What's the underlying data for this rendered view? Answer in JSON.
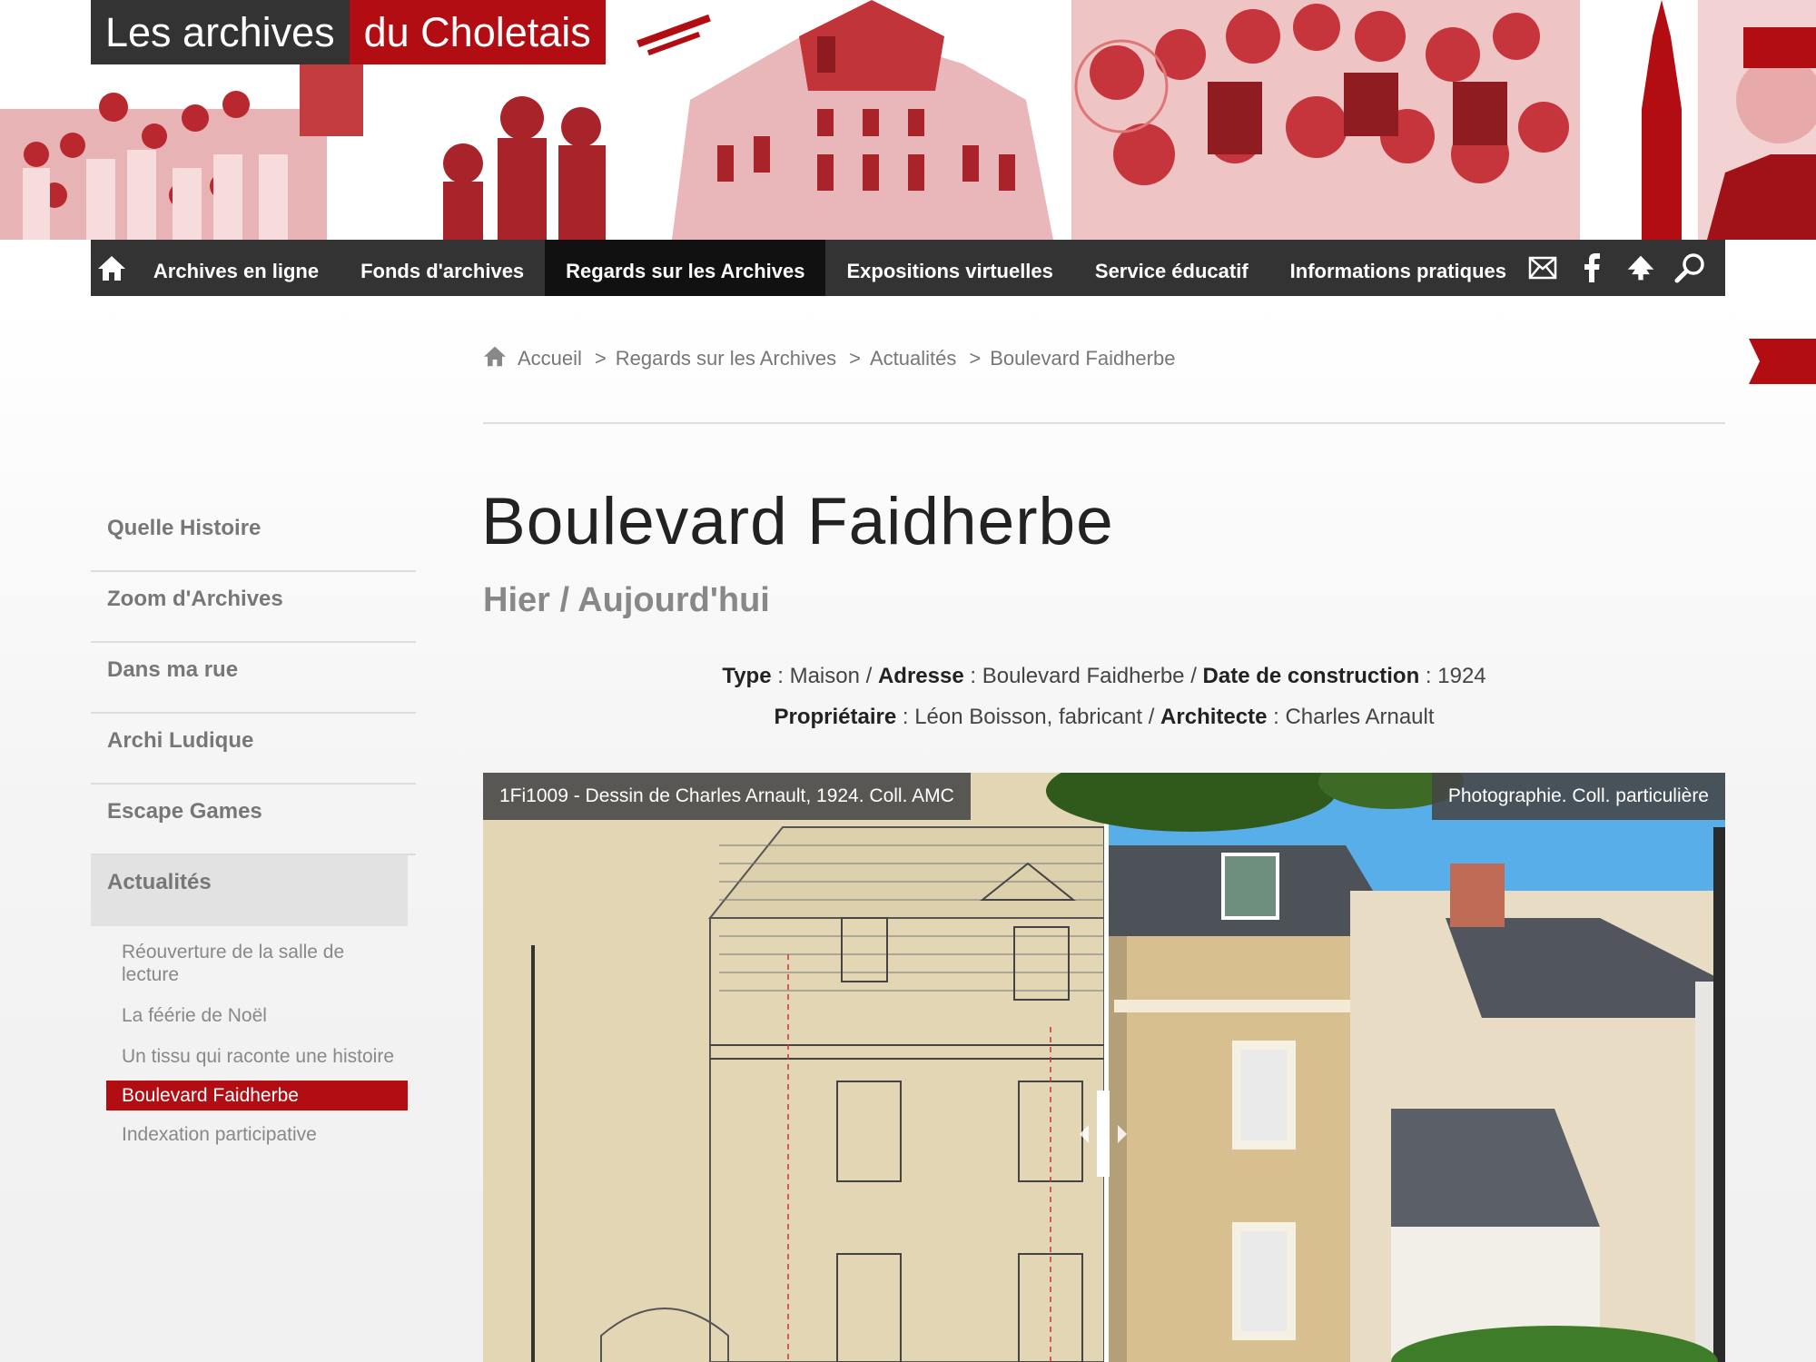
{
  "site": {
    "logo_part1": "Les archives",
    "logo_part2": "du Choletais",
    "brand_color": "#b30d14",
    "dark_color": "#333333"
  },
  "nav": {
    "home_icon": "home-icon",
    "items": [
      {
        "label": "Archives en ligne",
        "active": false
      },
      {
        "label": "Fonds d'archives",
        "active": false
      },
      {
        "label": "Regards sur les Archives",
        "active": true
      },
      {
        "label": "Expositions virtuelles",
        "active": false
      },
      {
        "label": "Service éducatif",
        "active": false
      },
      {
        "label": "Informations pratiques",
        "active": false
      }
    ],
    "icons": [
      "mail-icon",
      "facebook-icon",
      "tree-icon",
      "search-icon"
    ]
  },
  "breadcrumb": {
    "home": "Accueil",
    "level1": "Regards sur les Archives",
    "level2": "Actualités",
    "current": "Boulevard Faidherbe",
    "separator": ">"
  },
  "sidebar": {
    "items": [
      {
        "label": "Quelle Histoire"
      },
      {
        "label": "Zoom d'Archives"
      },
      {
        "label": "Dans ma rue"
      },
      {
        "label": "Archi Ludique"
      },
      {
        "label": "Escape Games"
      },
      {
        "label": "Actualités",
        "active": true
      }
    ],
    "sub_items": [
      {
        "label": "Réouverture de la salle de lecture"
      },
      {
        "label": "La féérie de Noël"
      },
      {
        "label": "Un tissu qui raconte une histoire"
      },
      {
        "label": "Boulevard Faidherbe",
        "active": true
      },
      {
        "label": "Indexation participative"
      }
    ]
  },
  "article": {
    "title": "Boulevard Faidherbe",
    "subtitle": "Hier / Aujourd'hui",
    "type_label": "Type",
    "type_value": "Maison",
    "address_label": "Adresse",
    "address_value": "Boulevard Faidherbe",
    "date_label": "Date de construction",
    "date_value": "1924",
    "owner_label": "Propriétaire",
    "owner_value": "Léon Boisson, fabricant",
    "architect_label": "Architecte",
    "architect_value": "Charles Arnault"
  },
  "comparison": {
    "left_caption": "1Fi1009 - Dessin de Charles Arnault, 1924. Coll. AMC",
    "right_caption": "Photographie. Coll. particulière",
    "slider_position": 0.5
  }
}
